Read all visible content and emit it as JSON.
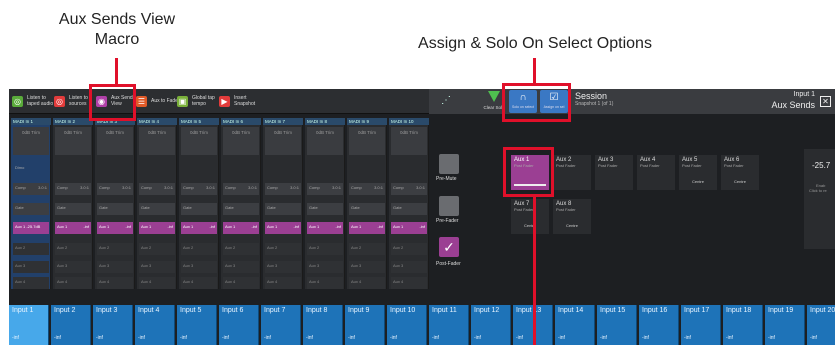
{
  "callouts": {
    "aux_sends_view_macro": "Aux Sends View\nMacro",
    "assign_solo": "Assign & Solo On Select Options"
  },
  "macros": [
    {
      "label": "Listen to taped audio",
      "color": "#5aab3a"
    },
    {
      "label": "Listen to sources",
      "color": "#e23b3b"
    },
    {
      "label": "Aux Sends View",
      "color": "#b040a8"
    },
    {
      "label": "Aux to Faders",
      "color": "#e05a28"
    },
    {
      "label": "Global tap tempo",
      "color": "#7ab03a"
    },
    {
      "label": "Insert Snapshot",
      "color": "#e23b3b"
    }
  ],
  "topbar": {
    "clear_solo": "Clear Solo",
    "solo_on_select": "Solo on select",
    "assign_on_sel": "Assign on sel",
    "session_title": "Session",
    "snapshot": "Snapshot 1 (of 1)",
    "right_title": "Input 1",
    "right_sub": "Aux Sends"
  },
  "channel_headers": [
    "MADI In 1",
    "MADI In 2",
    "MADI In 3",
    "MADI In 4",
    "MADI In 5",
    "MADI In 6",
    "MADI In 7",
    "MADI In 8",
    "MADI In 9",
    "MADI In 10"
  ],
  "strip": {
    "trim": "0dB Trim",
    "comp": "Comp",
    "comp_ratio": "3.0:1",
    "gate": "Gate",
    "aux1": "Aux 1",
    "aux1_first": "Aux 1 -25.7dB",
    "aux1_value": "-inf",
    "aux2": "Aux 2",
    "aux3": "Aux 3",
    "aux4": "Aux 4",
    "dimo": "Dimo"
  },
  "side_buttons": {
    "pre_mute": "Pre-Mute",
    "pre_fader": "Pre-Fader",
    "post_fader": "Post-Fader"
  },
  "aux_grid": [
    {
      "name": "Aux 1",
      "sub": "Post Fader",
      "pan": ""
    },
    {
      "name": "Aux 2",
      "sub": "Post Fader",
      "pan": ""
    },
    {
      "name": "Aux 3",
      "sub": "Post Fader",
      "pan": ""
    },
    {
      "name": "Aux 4",
      "sub": "Post Fader",
      "pan": ""
    },
    {
      "name": "Aux 5",
      "sub": "Post Fader",
      "pan": "Centre"
    },
    {
      "name": "Aux 6",
      "sub": "Post Fader",
      "pan": "Centre"
    },
    {
      "name": "Aux 7",
      "sub": "Post Fader",
      "pan": "Centre"
    },
    {
      "name": "Aux 8",
      "sub": "Post Fader",
      "pan": "Centre"
    }
  ],
  "right_panel": {
    "value": "-25.7",
    "line1": "Enab",
    "line2": "Click to re"
  },
  "inputs": [
    "Input 1",
    "Input 2",
    "Input 3",
    "Input 4",
    "Input 5",
    "Input 6",
    "Input 7",
    "Input 8",
    "Input 9",
    "Input 10",
    "Input 11",
    "Input 12",
    "Input 13",
    "Input 14",
    "Input 15",
    "Input 16",
    "Input 17",
    "Input 18",
    "Input 19",
    "Input 20"
  ],
  "input_value": "-inf"
}
